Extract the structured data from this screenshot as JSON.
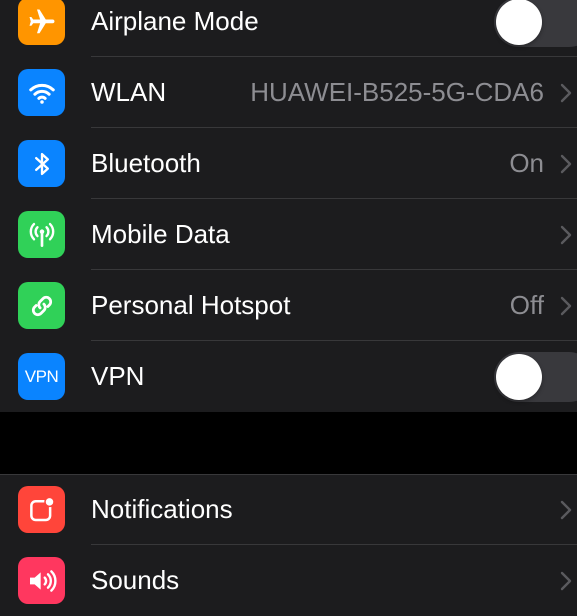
{
  "connectivity": {
    "airplane": {
      "label": "Airplane Mode",
      "icon": "airplane-icon",
      "color": "#ff9500",
      "toggle_on": false
    },
    "wlan": {
      "label": "WLAN",
      "value": "HUAWEI-B525-5G-CDA6",
      "icon": "wifi-icon",
      "color": "#0a84ff"
    },
    "bluetooth": {
      "label": "Bluetooth",
      "value": "On",
      "icon": "bluetooth-icon",
      "color": "#0a84ff"
    },
    "mobile_data": {
      "label": "Mobile Data",
      "icon": "antenna-icon",
      "color": "#30d158"
    },
    "hotspot": {
      "label": "Personal Hotspot",
      "value": "Off",
      "icon": "hotspot-link-icon",
      "color": "#30d158"
    },
    "vpn": {
      "label": "VPN",
      "icon_text": "VPN",
      "color": "#0a84ff",
      "toggle_on": false
    }
  },
  "notifications_group": {
    "notifications": {
      "label": "Notifications",
      "icon": "notifications-icon",
      "color": "#ff453a"
    },
    "sounds": {
      "label": "Sounds",
      "icon": "speaker-icon",
      "color": "#ff375f"
    }
  },
  "colors": {
    "background": "#000000",
    "cell": "#1c1c1e",
    "separator": "#38383a",
    "secondary_text": "#8d8d92",
    "toggle_off": "#39393d"
  }
}
